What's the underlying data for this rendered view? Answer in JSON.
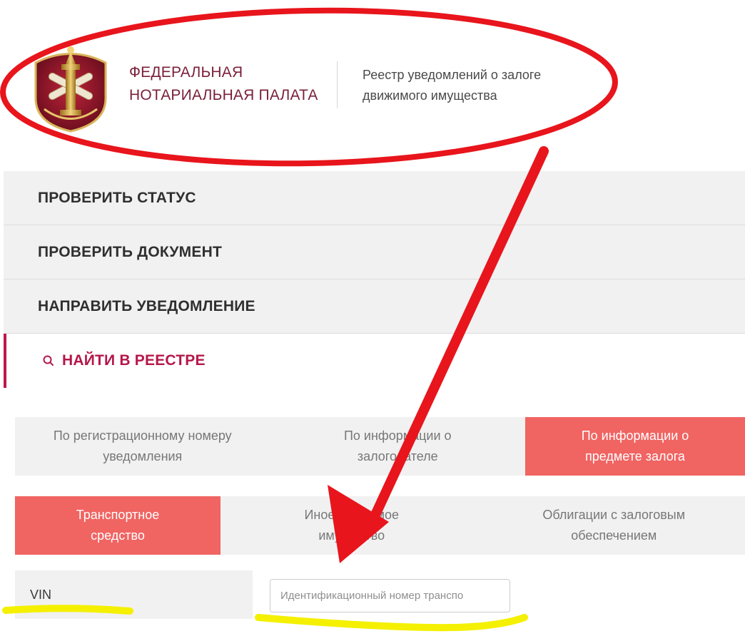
{
  "header": {
    "org_name_line1": "ФЕДЕРАЛЬНАЯ",
    "org_name_line2": "НОТАРИАЛЬНАЯ ПАЛАТА",
    "registry_line1": "Реестр уведомлений о залоге",
    "registry_line2": "движимого имущества",
    "logo_icon": "notary-emblem-icon"
  },
  "menu": {
    "items": [
      {
        "label": "ПРОВЕРИТЬ СТАТУС"
      },
      {
        "label": "ПРОВЕРИТЬ ДОКУМЕНТ"
      },
      {
        "label": "НАПРАВИТЬ УВЕДОМЛЕНИЕ"
      }
    ],
    "active": {
      "label": "НАЙТИ В РЕЕСТРЕ",
      "icon": "search-icon"
    }
  },
  "search_type_tabs": [
    {
      "line1": "По регистрационному номеру",
      "line2": "уведомления",
      "active": false
    },
    {
      "line1": "По информации о",
      "line2": "залогодателе",
      "active": false
    },
    {
      "line1": "По информации о",
      "line2": "предмете залога",
      "active": true
    }
  ],
  "property_type_tabs": [
    {
      "line1": "Транспортное",
      "line2": "средство",
      "active": true
    },
    {
      "line1": "Иное движимое",
      "line2": "имущество",
      "active": false
    },
    {
      "line1": "Облигации с залоговым",
      "line2": "обеспечением",
      "active": false
    }
  ],
  "vin_field": {
    "label": "VIN",
    "placeholder": "Идентификационный номер транспо",
    "value": ""
  },
  "colors": {
    "brand": "#7a1f3a",
    "accent": "#c0164a",
    "active_tab": "#f06462",
    "annotation_red": "#e8151c",
    "annotation_yellow": "#f4f000"
  }
}
